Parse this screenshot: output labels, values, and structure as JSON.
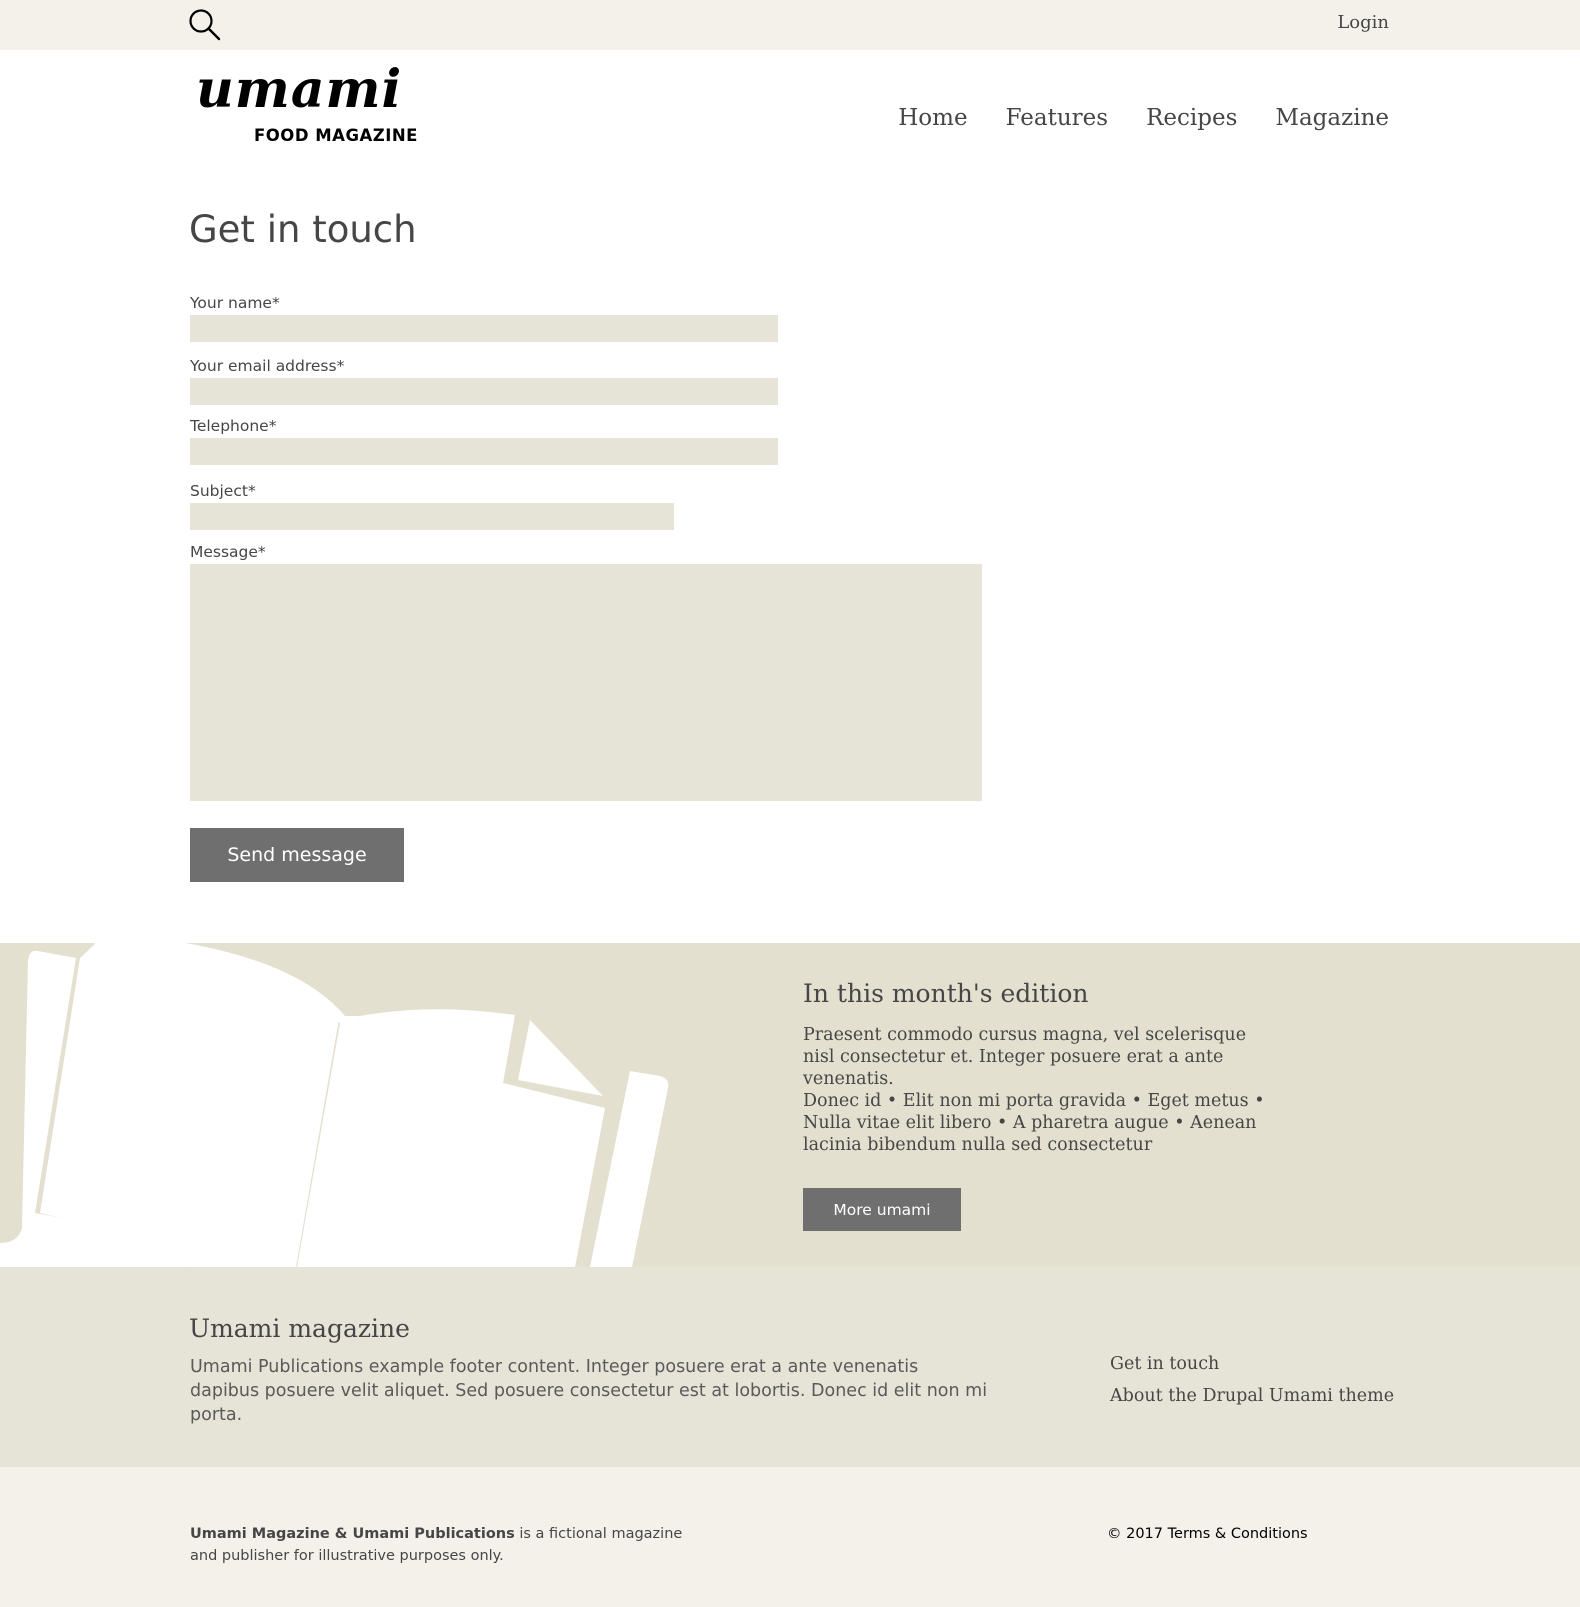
{
  "topbar": {
    "search_icon": "search-icon",
    "login_label": "Login"
  },
  "header": {
    "logo_script": "umami",
    "logo_subtitle": "FOOD MAGAZINE",
    "nav": [
      {
        "label": "Home"
      },
      {
        "label": "Features"
      },
      {
        "label": "Recipes"
      },
      {
        "label": "Magazine"
      }
    ]
  },
  "form": {
    "title": "Get in touch",
    "name_label": "Your name*",
    "name_value": "",
    "email_label": "Your email address*",
    "email_value": "",
    "phone_label": "Telephone*",
    "phone_value": "",
    "subject_label": "Subject*",
    "subject_value": "",
    "message_label": "Message*",
    "message_value": "",
    "submit_label": "Send message"
  },
  "banner": {
    "heading": "In this month's edition",
    "paragraph1": "Praesent commodo cursus magna, vel scelerisque nisl consectetur et. Integer posuere erat a ante venenatis.",
    "paragraph2": "Donec id • Elit non mi porta gravida • Eget metus • Nulla vitae elit libero • A pharetra augue • Aenean lacinia bibendum nulla sed consectetur",
    "button_label": "More umami"
  },
  "footer": {
    "title": "Umami magazine",
    "text": "Umami Publications example footer content. Integer posuere erat a ante venenatis dapibus posuere velit aliquet. Sed posuere consectetur est at lobortis. Donec id elit non mi porta.",
    "links": [
      {
        "label": "Get in touch"
      },
      {
        "label": "About the Drupal Umami theme"
      }
    ]
  },
  "bottom": {
    "note_bold": "Umami Magazine & Umami Publications",
    "note_rest": " is a fictional magazine and publisher for illustrative purposes only.",
    "copyright_prefix": "© 2017 ",
    "terms_label": "Terms & Conditions"
  },
  "colors": {
    "topbar_bg": "#f3f1ea",
    "input_bg": "#e6e3d7",
    "banner_bg": "#e3e0d0",
    "button_bg": "#6f6f6f",
    "text": "#464646"
  }
}
